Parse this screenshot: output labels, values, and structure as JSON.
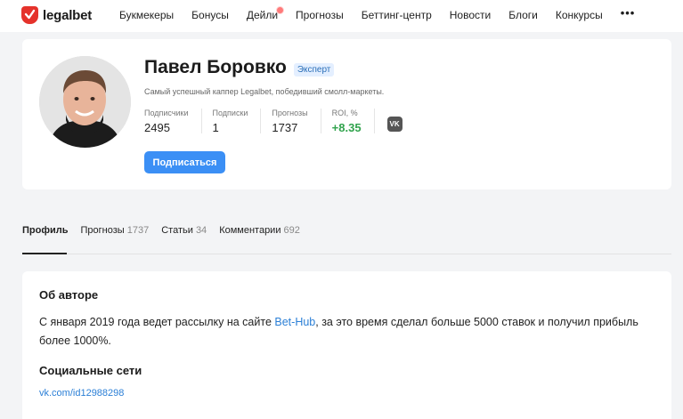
{
  "header": {
    "logo_text": "legalbet",
    "nav": [
      "Букмекеры",
      "Бонусы",
      "Дейли",
      "Прогнозы",
      "Беттинг-центр",
      "Новости",
      "Блоги",
      "Конкурсы"
    ],
    "more": "•••"
  },
  "profile": {
    "name": "Павел Боровко",
    "badge": "Эксперт",
    "bio": "Самый успешный каппер Legalbet, победивший смолл-маркеты.",
    "stats": [
      {
        "label": "Подписчики",
        "value": "2495"
      },
      {
        "label": "Подписки",
        "value": "1"
      },
      {
        "label": "Прогнозы",
        "value": "1737"
      },
      {
        "label": "ROI, %",
        "value": "+8.35"
      }
    ],
    "vk_label": "VK",
    "subscribe_label": "Подписаться"
  },
  "tabs": [
    {
      "label": "Профиль",
      "count": ""
    },
    {
      "label": "Прогнозы",
      "count": "1737"
    },
    {
      "label": "Статьи",
      "count": "34"
    },
    {
      "label": "Комментарии",
      "count": "692"
    }
  ],
  "about": {
    "title": "Об авторе",
    "text_before": "С января 2019 года ведет рассылку на сайте ",
    "text_link": "Bet-Hub",
    "text_after": ", за это время сделал больше 5000 ставок и получил прибыль более 1000%.",
    "social_title": "Социальные сети",
    "social_link": "vk.com/id12988298"
  },
  "colors": {
    "brand_red": "#e5322b",
    "accent_blue": "#3b8ff5",
    "roi_green": "#31a34d"
  }
}
